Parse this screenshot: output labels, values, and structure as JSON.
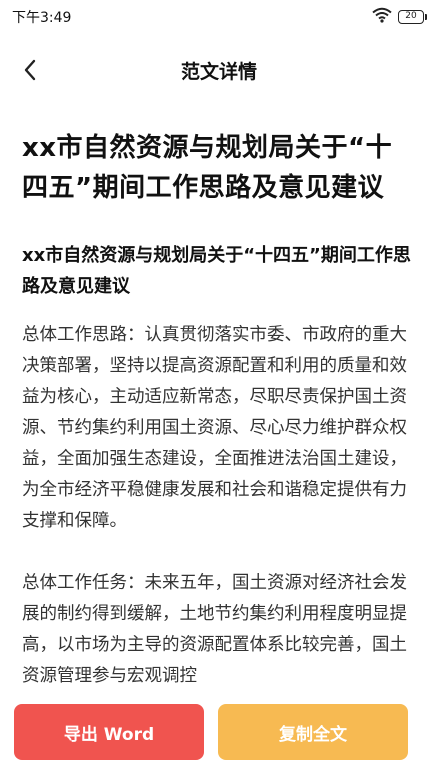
{
  "status_bar": {
    "time": "下午3:49",
    "battery": "20",
    "wifi_icon": "wifi-icon"
  },
  "nav": {
    "back_icon": "chevron-left-icon",
    "title": "范文详情"
  },
  "document": {
    "title": "xx市自然资源与规划局关于“十四五”期间工作思路及意见建议",
    "subtitle": "xx市自然资源与规划局关于“十四五”期间工作思路及意见建议",
    "paragraphs": [
      "总体工作思路：认真贯彻落实市委、市政府的重大决策部署，坚持以提高资源配置和利用的质量和效益为核心，主动适应新常态，尽职尽责保护国土资源、节约集约利用国土资源、尽心尽力维护群众权益，全面加强生态建设，全面推进法治国土建设，为全市经济平稳健康发展和社会和谐稳定提供有力支撑和保障。",
      "总体工作任务：未来五年，国土资源对经济社会发展的制约得到缓解，土地节约集约利用程度明显提高，以市场为主导的资源配置体系比较完善，国土资源管理参与宏观调控"
    ]
  },
  "actions": {
    "export_label": "导出 Word",
    "copy_label": "复制全文"
  },
  "colors": {
    "export_button": "#f0544f",
    "copy_button": "#f7ba52"
  }
}
